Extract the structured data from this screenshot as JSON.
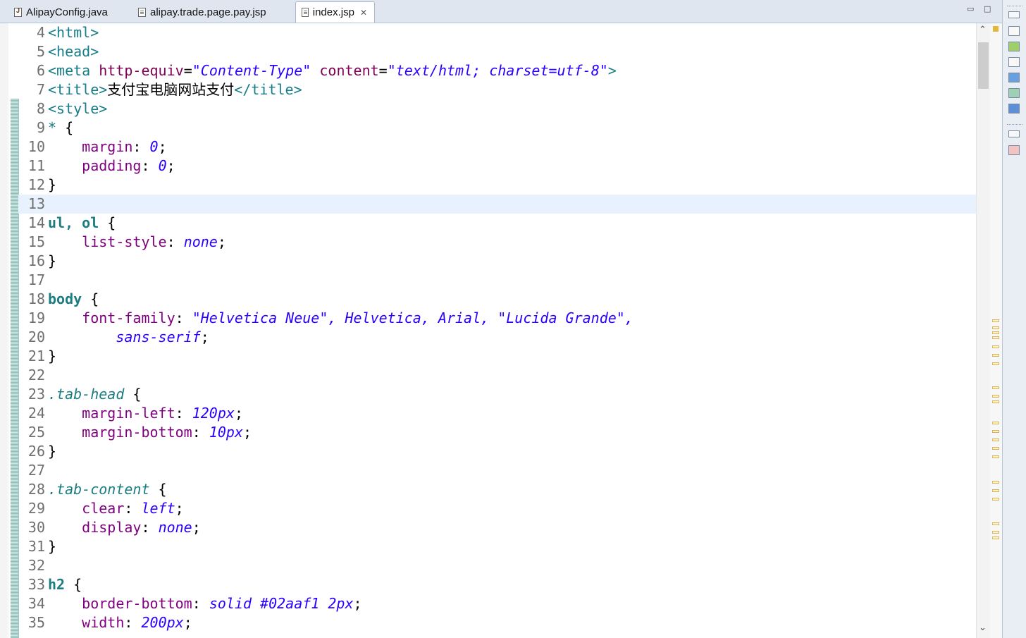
{
  "tabs": [
    {
      "label": "AlipayConfig.java",
      "icon": "java-file-icon",
      "active": false
    },
    {
      "label": "alipay.trade.page.pay.jsp",
      "icon": "jsp-file-icon",
      "active": false
    },
    {
      "label": "index.jsp",
      "icon": "jsp-file-icon",
      "active": true,
      "close": "✕"
    }
  ],
  "window_controls": {
    "minimize": "▭",
    "maximize": "□"
  },
  "editor": {
    "current_line": "13",
    "lines": [
      {
        "n": "4"
      },
      {
        "n": "5"
      },
      {
        "n": "6"
      },
      {
        "n": "7",
        "title_text": "支付宝电脑网站支付"
      },
      {
        "n": "8"
      },
      {
        "n": "9"
      },
      {
        "n": "10"
      },
      {
        "n": "11"
      },
      {
        "n": "12"
      },
      {
        "n": "13"
      },
      {
        "n": "14"
      },
      {
        "n": "15"
      },
      {
        "n": "16"
      },
      {
        "n": "17"
      },
      {
        "n": "18"
      },
      {
        "n": "19"
      },
      {
        "n": "20"
      },
      {
        "n": "21"
      },
      {
        "n": "22"
      },
      {
        "n": "23"
      },
      {
        "n": "24"
      },
      {
        "n": "25"
      },
      {
        "n": "26"
      },
      {
        "n": "27"
      },
      {
        "n": "28"
      },
      {
        "n": "29"
      },
      {
        "n": "30"
      },
      {
        "n": "31"
      },
      {
        "n": "32"
      },
      {
        "n": "33"
      },
      {
        "n": "34"
      },
      {
        "n": "35"
      }
    ]
  },
  "scrollbar": {
    "up": "⌃",
    "down": "⌄",
    "position_fraction": 0.0
  },
  "colors": {
    "tag": "#177e89",
    "attr": "#7f0055",
    "value": "#2a00ff",
    "property": "#7f007f",
    "selector": "#1b7d81",
    "current_line": "#e8f2fe"
  }
}
